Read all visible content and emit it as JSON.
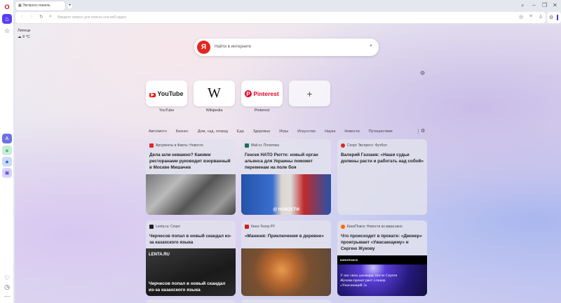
{
  "browser": {
    "tab_title": "Экспресс-панель",
    "new_tab": "+",
    "address_placeholder": "Введите запрос для поиска или веб-адрес",
    "window_controls": [
      "search-icon",
      "minimize-icon",
      "restore-icon",
      "close-icon"
    ]
  },
  "weather": {
    "city": "Липецк",
    "temp": "9 °C"
  },
  "search": {
    "logo": "Я",
    "placeholder": "Найти в интернете"
  },
  "speed_dial": [
    {
      "label": "YouTube",
      "logo": "YouTube"
    },
    {
      "label": "Wikipedia",
      "logo": "W"
    },
    {
      "label": "Pinterest",
      "logo": "Pinterest"
    },
    {
      "label": "",
      "logo": "+"
    }
  ],
  "categories": [
    "Авто/мото",
    "Бизнес",
    "Дом, сад, огород",
    "Еда",
    "Здоровье",
    "Игры",
    "Искусство",
    "Наука",
    "Новости",
    "Путешествия"
  ],
  "cards": [
    {
      "source": "Аргументы и Факты: Новости",
      "title": "Дела шли неважно? Какими ресторанами руководит взорванный в Москве Мишачев",
      "overlay": ""
    },
    {
      "source": "Mail.ru: Политика",
      "title": "Генсек НАТО Рютте: новый орган альянса для Украины поможет переменам на поле боя",
      "overlay": "@ НОВОСТИ"
    },
    {
      "source": "Спорт Экспресс: Футбол",
      "title": "Валерий Газзаев: «Наши судьи должны расти и работать над собой»",
      "overlay": ""
    },
    {
      "source": "Lenta.ru: Спорт",
      "title": "Черчесов попал в новый скандал из-за казахского языка",
      "overlay": "Черчесов попал в новый скандал из-за казахского языка",
      "brand": "LENTA.RU"
    },
    {
      "source": "Кино-Театр.РУ",
      "title": "«Манюня: Приключения в деревне»",
      "overlay": ""
    },
    {
      "source": "КиноПоиск: Новости из мира кино",
      "title": "Что происходит в прокате: «Джокер» проигрывает «Ужасающему» и Сергею Жукову",
      "overlay": "У нас свои джокеры: после Сергея Жукова прокат рвет слэшер «Ужасающий 3»",
      "brand": "КИНОПОИСК"
    }
  ]
}
